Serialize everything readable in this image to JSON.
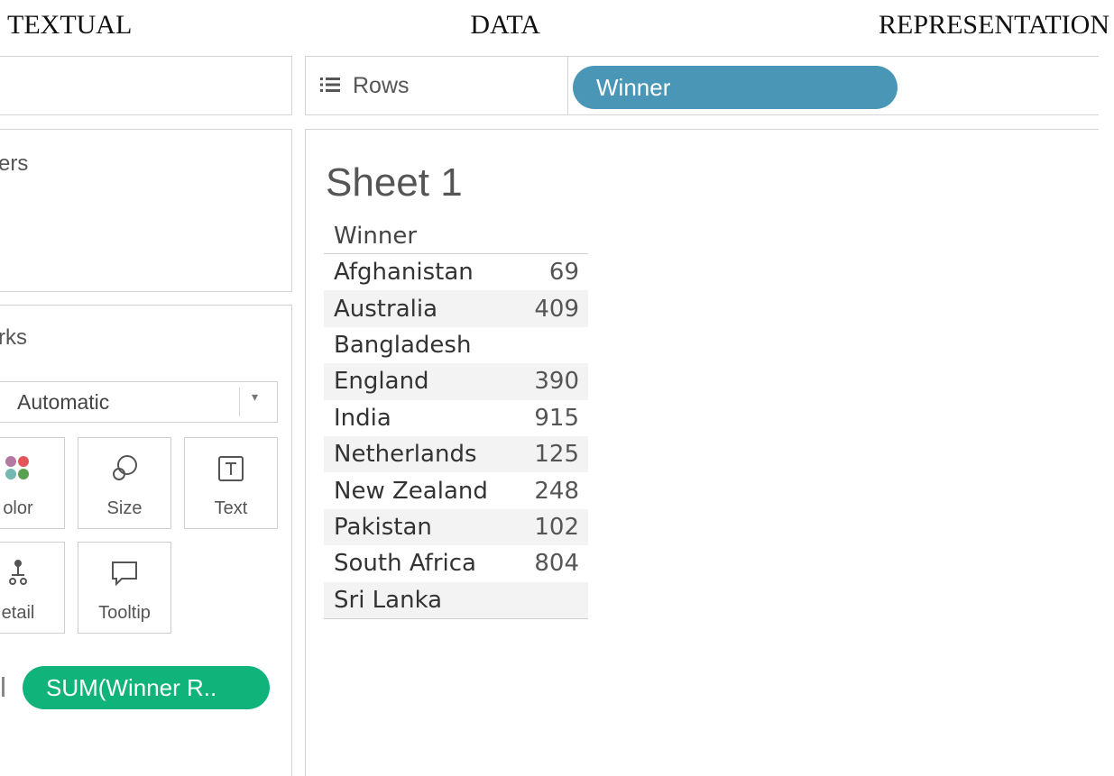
{
  "heading": {
    "word1": "TEXTUAL",
    "word2": "DATA",
    "word3": "REPRESENTATION"
  },
  "filters": {
    "title": "ers"
  },
  "marks": {
    "title": "rks",
    "mark_type": "Automatic",
    "cards": {
      "color": "olor",
      "size": "Size",
      "text": "Text",
      "detail": "etail",
      "tooltip": "Tooltip"
    },
    "pill": "SUM(Winner R.."
  },
  "rows": {
    "label": "Rows",
    "pill": "Winner"
  },
  "colors": {
    "winner_pill": "#4a96b6",
    "sum_pill": "#10b47a"
  },
  "sheet": {
    "title": "Sheet 1",
    "header": "Winner",
    "rows": [
      {
        "name": "Afghanistan",
        "value": "69"
      },
      {
        "name": "Australia",
        "value": "409"
      },
      {
        "name": "Bangladesh",
        "value": ""
      },
      {
        "name": "England",
        "value": "390"
      },
      {
        "name": "India",
        "value": "915"
      },
      {
        "name": "Netherlands",
        "value": "125"
      },
      {
        "name": "New Zealand",
        "value": "248"
      },
      {
        "name": "Pakistan",
        "value": "102"
      },
      {
        "name": "South Africa",
        "value": "804"
      },
      {
        "name": "Sri Lanka",
        "value": ""
      }
    ]
  }
}
